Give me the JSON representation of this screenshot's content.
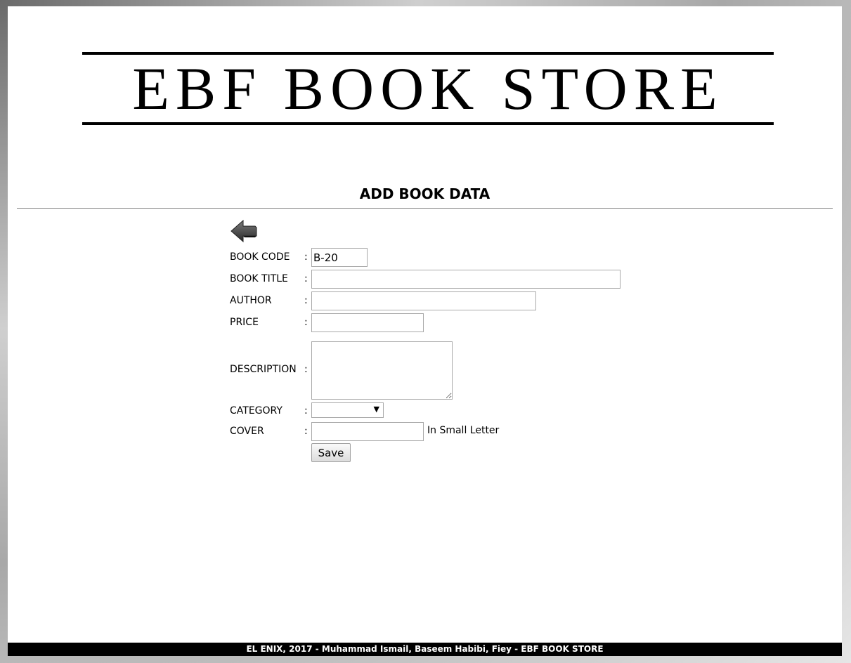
{
  "header": {
    "logo_text": "EBF BOOK STORE"
  },
  "page_title": "ADD BOOK DATA",
  "back_icon": "back-arrow-icon",
  "form": {
    "separator": ":",
    "book_code": {
      "label": "BOOK CODE",
      "value": "B-20"
    },
    "book_title": {
      "label": "BOOK TITLE",
      "value": ""
    },
    "author": {
      "label": "AUTHOR",
      "value": ""
    },
    "price": {
      "label": "PRICE",
      "value": ""
    },
    "description": {
      "label": "DESCRIPTION",
      "value": ""
    },
    "category": {
      "label": "CATEGORY",
      "selected": ""
    },
    "cover": {
      "label": "COVER",
      "value": "",
      "hint": "In Small Letter"
    },
    "save_label": "Save"
  },
  "footer": {
    "text": "EL ENIX, 2017 - Muhammad Ismail, Baseem Habibi, Fiey - EBF BOOK STORE"
  }
}
